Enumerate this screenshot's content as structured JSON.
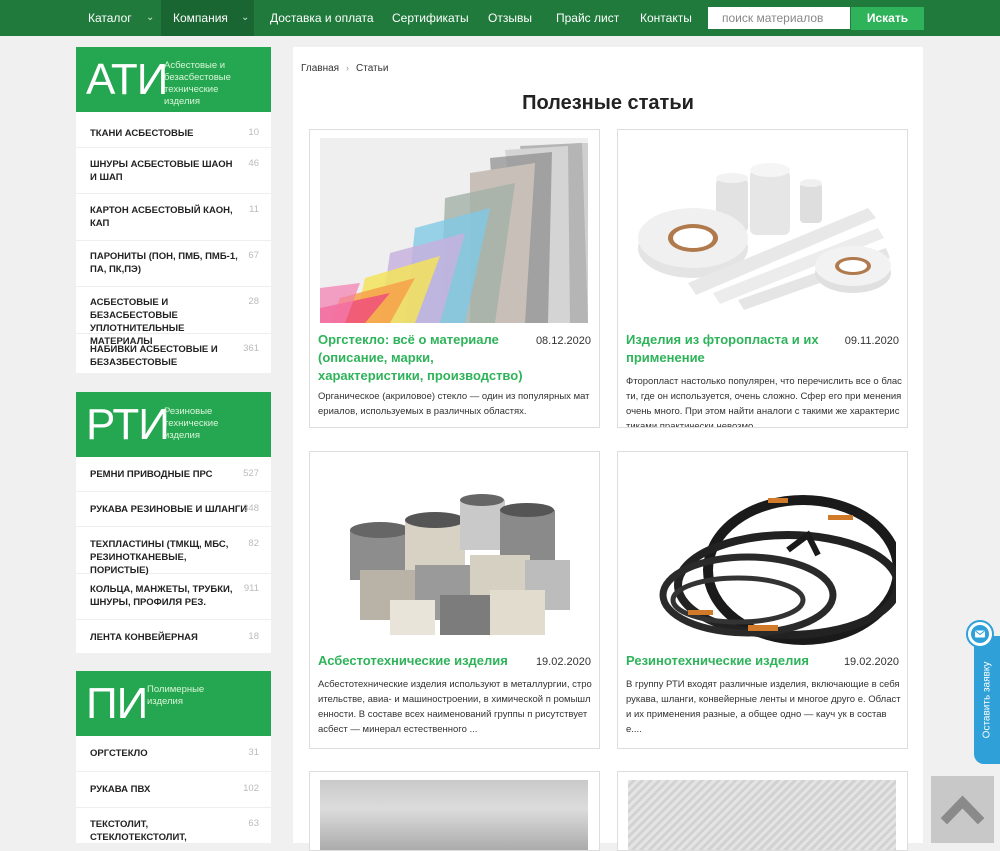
{
  "nav": {
    "items": [
      {
        "label": "Каталог",
        "has_caret": true
      },
      {
        "label": "Компания",
        "has_caret": true,
        "active": true
      },
      {
        "label": "Доставка и оплата"
      },
      {
        "label": "Сертификаты"
      },
      {
        "label": "Отзывы"
      },
      {
        "label": "Прайс лист"
      },
      {
        "label": "Контакты"
      }
    ],
    "search_placeholder": "поиск материалов",
    "search_button": "Искать"
  },
  "sidebar": [
    {
      "abbr": "АТИ",
      "desc": "Асбестовые и безасбестовые технические изделия",
      "items": [
        {
          "label": "ТКАНИ АСБЕСТОВЫЕ",
          "count": "10"
        },
        {
          "label": "ШНУРЫ АСБЕСТОВЫЕ ШАОН И ШАП",
          "count": "46"
        },
        {
          "label": "КАРТОН АСБЕСТОВЫЙ КАОН, КАП",
          "count": "11"
        },
        {
          "label": "ПАРОНИТЫ (ПОН, ПМБ, ПМБ-1, ПА, ПК,ПЭ)",
          "count": "67"
        },
        {
          "label": "АСБЕСТОВЫЕ И БЕЗАСБЕСТОВЫЕ УПЛОТНИТЕЛЬНЫЕ МАТЕРИАЛЫ",
          "count": "28"
        },
        {
          "label": "НАБИВКИ АСБЕСТОВЫЕ И БЕЗАЗБЕСТОВЫЕ",
          "count": "361"
        }
      ]
    },
    {
      "abbr": "РТИ",
      "desc": "Резиновые технические изделия",
      "items": [
        {
          "label": "РЕМНИ ПРИВОДНЫЕ ПРС",
          "count": "527"
        },
        {
          "label": "РУКАВА РЕЗИНОВЫЕ И ШЛАНГИ",
          "count": "348"
        },
        {
          "label": "ТЕХПЛАСТИНЫ (ТМКЩ, МБС, РЕЗИНОТКАНЕВЫЕ, ПОРИСТЫЕ)",
          "count": "82"
        },
        {
          "label": "КОЛЬЦА, МАНЖЕТЫ, ТРУБКИ, ШНУРЫ, ПРОФИЛЯ РЕЗ.",
          "count": "911"
        },
        {
          "label": "ЛЕНТА КОНВЕЙЕРНАЯ",
          "count": "18"
        }
      ]
    },
    {
      "abbr": "ПИ",
      "desc": "Полимерные изделия",
      "items": [
        {
          "label": "ОРГСТЕКЛО",
          "count": "31"
        },
        {
          "label": "РУКАВА ПВХ",
          "count": "102"
        },
        {
          "label": "ТЕКСТОЛИТ, СТЕКЛОТЕКСТОЛИТ,",
          "count": "63"
        }
      ]
    }
  ],
  "breadcrumb": {
    "home": "Главная",
    "sep": "›",
    "current": "Статьи"
  },
  "page_title": "Полезные статьи",
  "articles": [
    {
      "title": "Оргстекло: всё о материале (описание, марки, характеристики, производство)",
      "date": "08.12.2020",
      "text": "Органическое (акриловое) стекло — один из популярных материалов, используемых в различных областях."
    },
    {
      "title": "Изделия из фторопласта и их применение",
      "date": "09.11.2020",
      "text": "Фторопласт настолько популярен, что перечислить все о бласти, где он используется, очень сложно. Сфер его при менения очень много. При этом найти аналоги с такими же характеристиками практически невозмо..."
    },
    {
      "title": "Асбестотехнические изделия",
      "date": "19.02.2020",
      "text": "Асбестотехнические изделия используют в металлургии, строительстве, авиа- и машиностроении, в химической п ромышленности. В составе всех наименований группы п рисутствует асбест — минерал естественного ..."
    },
    {
      "title": "Резинотехнические изделия",
      "date": "19.02.2020",
      "text": "В группу РТИ входят различные изделия, включающие в себя рукава, шланги, конвейерные ленты и многое друго е. Области их применения разные, а общее одно — кауч ук в составе...."
    }
  ],
  "widgets": {
    "feedback_label": "Оставить заявку"
  },
  "colors": {
    "nav_bg": "#1f7a3b",
    "accent_green": "#2fb35a",
    "sidebar_green": "#25a651",
    "feedback_blue": "#2fa0d8"
  }
}
